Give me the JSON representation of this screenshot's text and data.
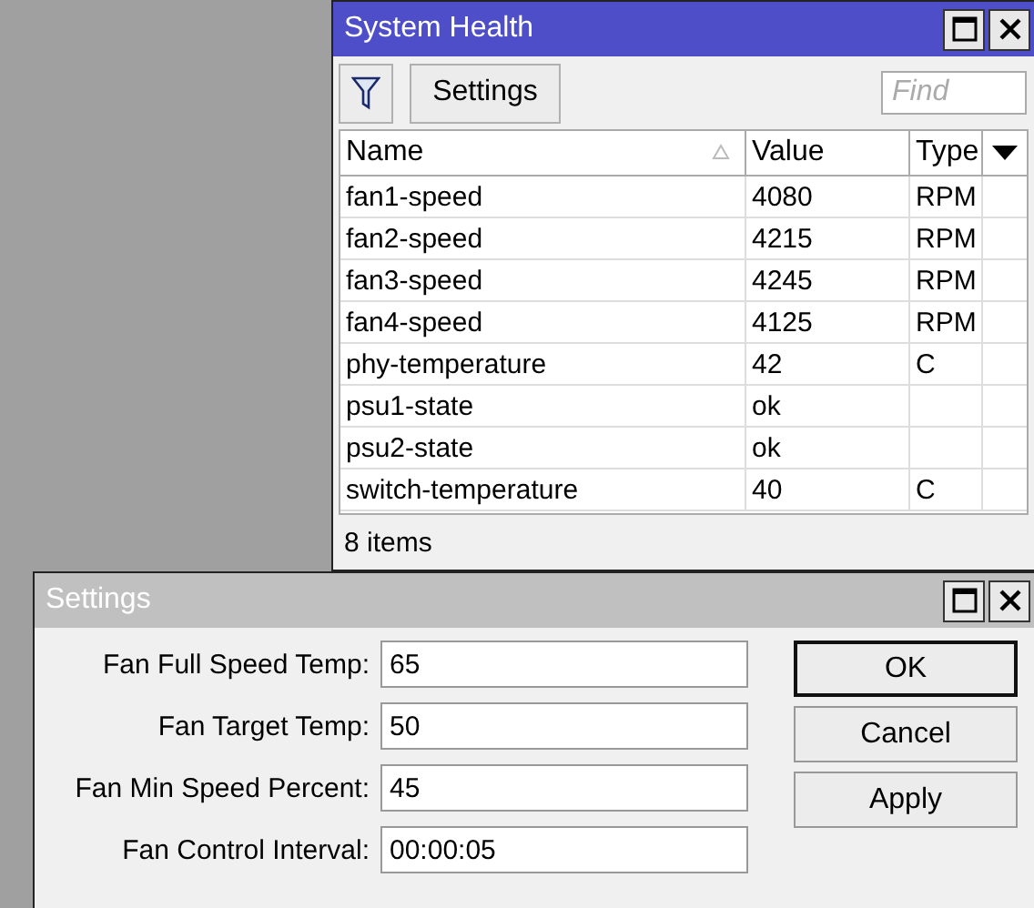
{
  "health_window": {
    "title": "System Health",
    "active": true,
    "toolbar": {
      "settings_button": "Settings",
      "find": {
        "placeholder": "Find"
      }
    },
    "table": {
      "columns": [
        {
          "label": "Name",
          "sorted": true
        },
        {
          "label": "Value",
          "sorted": false
        },
        {
          "label": "Type",
          "sorted": false
        }
      ],
      "rows": [
        {
          "name": "fan1-speed",
          "value": "4080",
          "type": "RPM"
        },
        {
          "name": "fan2-speed",
          "value": "4215",
          "type": "RPM"
        },
        {
          "name": "fan3-speed",
          "value": "4245",
          "type": "RPM"
        },
        {
          "name": "fan4-speed",
          "value": "4125",
          "type": "RPM"
        },
        {
          "name": "phy-temperature",
          "value": "42",
          "type": "C"
        },
        {
          "name": "psu1-state",
          "value": "ok",
          "type": ""
        },
        {
          "name": "psu2-state",
          "value": "ok",
          "type": ""
        },
        {
          "name": "switch-temperature",
          "value": "40",
          "type": "C"
        }
      ]
    },
    "status_bar": "8 items"
  },
  "settings_window": {
    "title": "Settings",
    "active": false,
    "fields": [
      {
        "label": "Fan Full Speed Temp:",
        "value": "65"
      },
      {
        "label": "Fan Target Temp:",
        "value": "50"
      },
      {
        "label": "Fan Min Speed Percent:",
        "value": "45"
      },
      {
        "label": "Fan Control Interval:",
        "value": "00:00:05"
      }
    ],
    "buttons": [
      {
        "label": "OK",
        "default": true
      },
      {
        "label": "Cancel",
        "default": false
      },
      {
        "label": "Apply",
        "default": false
      }
    ]
  }
}
